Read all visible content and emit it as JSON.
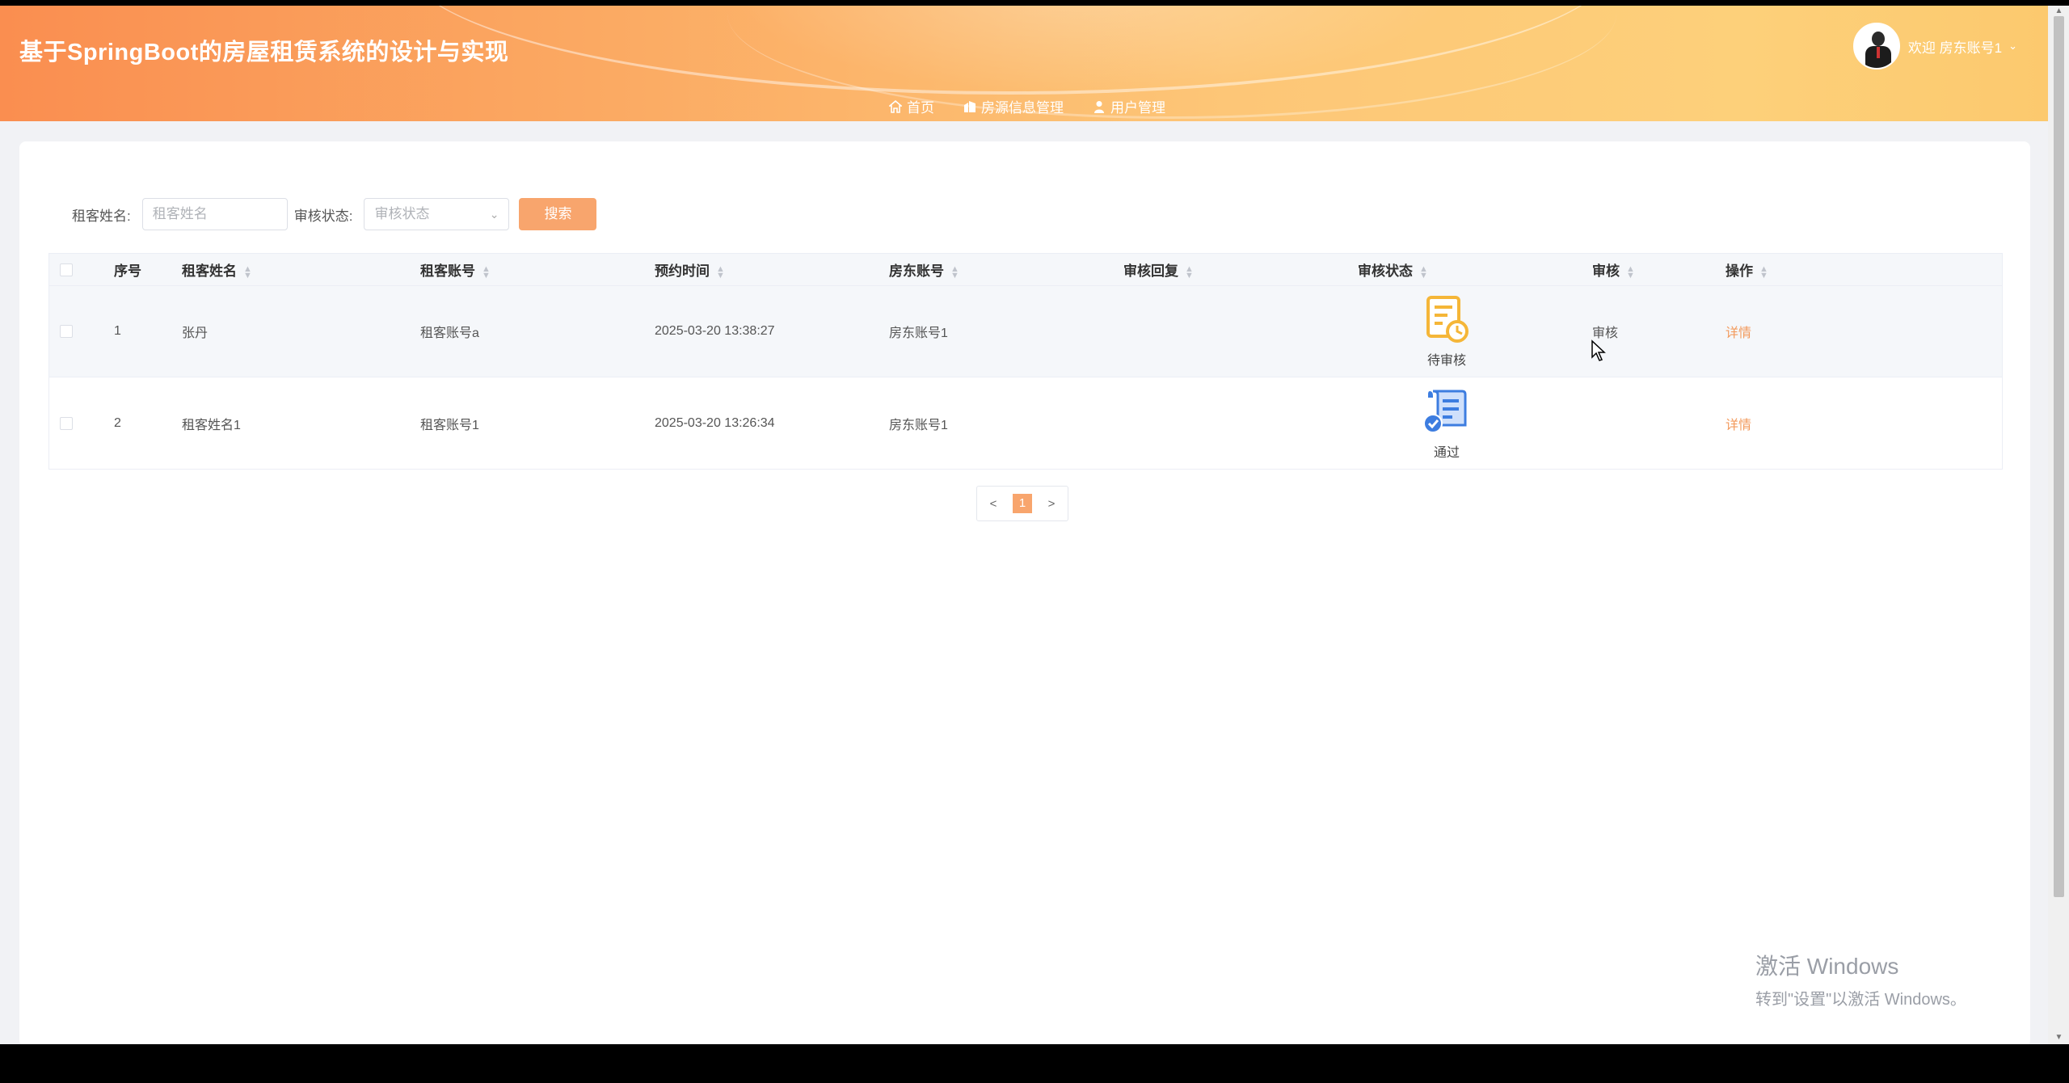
{
  "header": {
    "title": "基于SpringBoot的房屋租赁系统的设计与实现",
    "welcome": "欢迎 房东账号1",
    "nav": [
      {
        "label": "首页",
        "icon": "home-icon"
      },
      {
        "label": "房源信息管理",
        "icon": "building-icon"
      },
      {
        "label": "用户管理",
        "icon": "user-icon"
      }
    ]
  },
  "search": {
    "name_label": "租客姓名:",
    "name_placeholder": "租客姓名",
    "status_label": "审核状态:",
    "status_placeholder": "审核状态",
    "button": "搜索"
  },
  "table": {
    "columns": [
      "序号",
      "租客姓名",
      "租客账号",
      "预约时间",
      "房东账号",
      "审核回复",
      "审核状态",
      "审核",
      "操作"
    ],
    "rows": [
      {
        "index": "1",
        "name": "张丹",
        "account": "租客账号a",
        "time": "2025-03-20 13:38:27",
        "landlord": "房东账号1",
        "reply": "",
        "status": "待审核",
        "status_icon": "pending-document-icon",
        "review": "审核",
        "action": "详情"
      },
      {
        "index": "2",
        "name": "租客姓名1",
        "account": "租客账号1",
        "time": "2025-03-20 13:26:34",
        "landlord": "房东账号1",
        "reply": "",
        "status": "通过",
        "status_icon": "approved-document-icon",
        "review": "",
        "action": "详情"
      }
    ]
  },
  "pager": {
    "prev": "<",
    "current": "1",
    "next": ">"
  },
  "watermark": {
    "line1": "激活 Windows",
    "line2": "转到\"设置\"以激活 Windows。"
  },
  "colors": {
    "accent": "#f8a56d",
    "header_start": "#fa8e50",
    "header_end": "#fdd07a",
    "pending": "#f5b638",
    "approved": "#3d7de0"
  }
}
